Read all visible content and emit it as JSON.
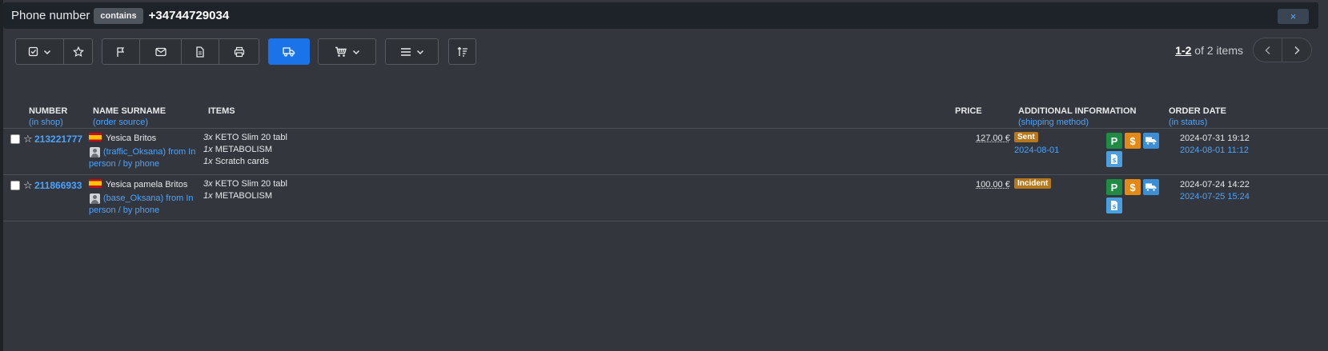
{
  "filter": {
    "field_label": "Phone number",
    "operator": "contains",
    "value": "+34744729034",
    "clear_icon": "×"
  },
  "toolbar": {
    "select_icon": "checkbox-dropdown-icon",
    "favorite_icon": "star-icon",
    "flag_icon": "flag-icon",
    "mail_icon": "mail-icon",
    "document_icon": "document-icon",
    "print_icon": "printer-icon",
    "shipping_icon": "truck-icon",
    "cart_icon": "cart-dropdown-icon",
    "menu_icon": "menu-dropdown-icon",
    "sort_icon": "sort-icon",
    "primary_color": "#1a73e8"
  },
  "pager": {
    "range": "1-2",
    "of_text": " of 2 items"
  },
  "table": {
    "columns": {
      "number": "NUMBER",
      "number_sub": "(in shop)",
      "name": "NAME SURNAME",
      "name_sub": "(order source)",
      "items": "ITEMS",
      "price": "PRICE",
      "additional": "ADDITIONAL INFORMATION",
      "additional_sub": "(shipping method)",
      "order_date": "ORDER DATE",
      "order_date_sub": "(in status)"
    },
    "rows": [
      {
        "number": "213221777",
        "name": "Yesica Britos",
        "source_line1": "(traffic_Oksana) from In",
        "source_line2": "person / by phone",
        "items": [
          {
            "qty": "3x",
            "name": "KETO Slim 20 tabl"
          },
          {
            "qty": "1x",
            "name": "METABOLISM"
          },
          {
            "qty": "1x",
            "name": "Scratch cards"
          }
        ],
        "price": "127.00 €",
        "status": "Sent",
        "status_date": "2024-08-01",
        "order_date": "2024-07-31 19:12",
        "in_status_date": "2024-08-01 11:12"
      },
      {
        "number": "211866933",
        "name": "Yesica pamela Britos",
        "source_line1": "(base_Oksana) from In",
        "source_line2": "person / by phone",
        "items": [
          {
            "qty": "3x",
            "name": "KETO Slim 20 tabl"
          },
          {
            "qty": "1x",
            "name": "METABOLISM"
          }
        ],
        "price": "100.00 €",
        "status": "Incident",
        "status_date": "",
        "order_date": "2024-07-24 14:22",
        "in_status_date": "2024-07-25 15:24"
      }
    ]
  },
  "icons": {
    "p_label": "P",
    "usd_label": "$"
  }
}
